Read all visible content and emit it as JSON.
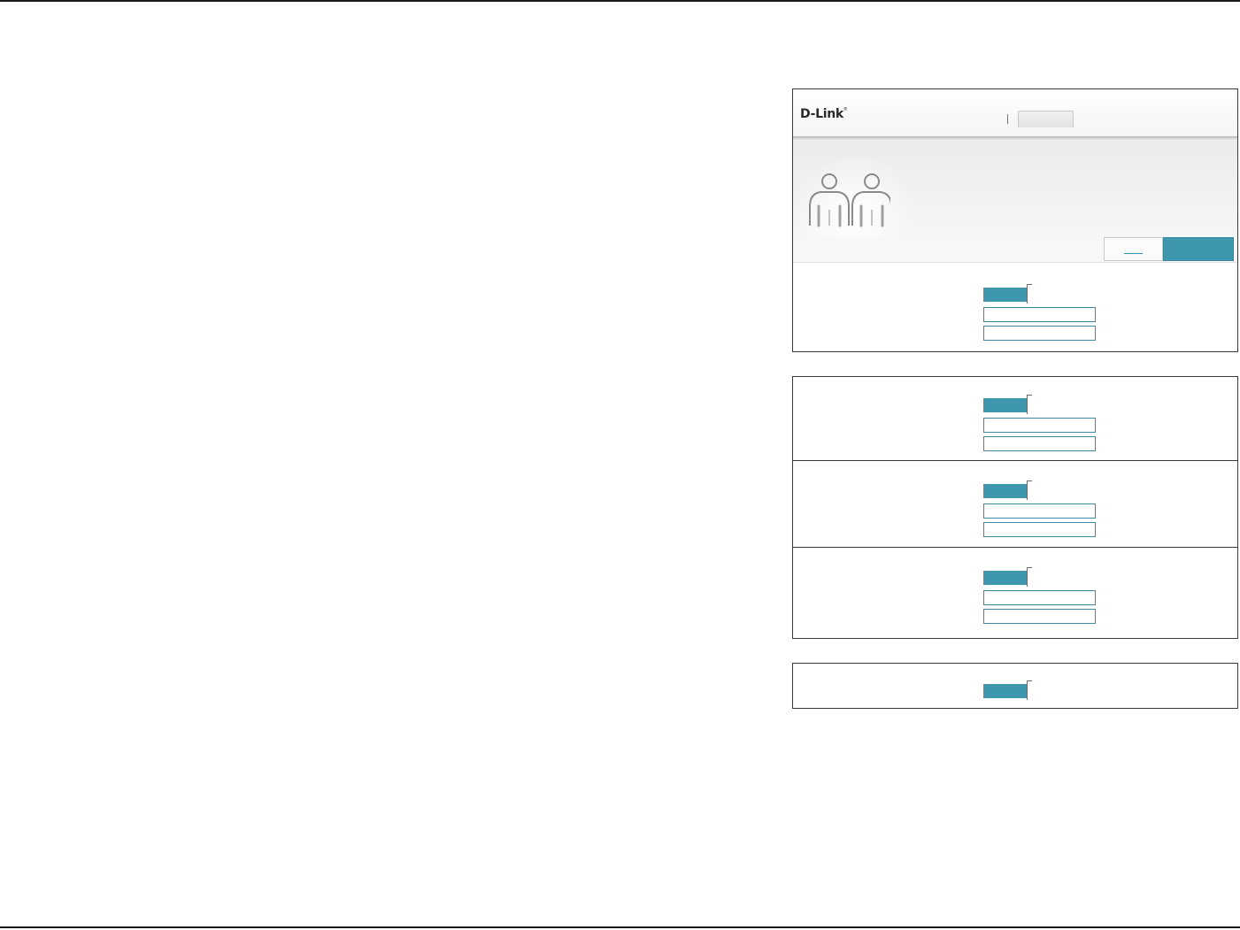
{
  "header": {
    "logo_text": "D-Link",
    "logo_mark": "®",
    "nav_tab_label": ""
  },
  "banner": {
    "icon": "users-icon"
  },
  "toolbar": {
    "link_label": "",
    "save_label": ""
  },
  "groups": [
    {
      "toggle_state": "on",
      "field1_value": "",
      "field2_value": ""
    },
    {
      "toggle_state": "on",
      "field1_value": "",
      "field2_value": ""
    },
    {
      "toggle_state": "on",
      "field1_value": "",
      "field2_value": ""
    },
    {
      "toggle_state": "on",
      "field1_value": "",
      "field2_value": ""
    },
    {
      "toggle_state": "on"
    }
  ],
  "colors": {
    "accent": "#3f97ad",
    "border": "#3a3a3a",
    "field_border": "#3f8aa0"
  }
}
